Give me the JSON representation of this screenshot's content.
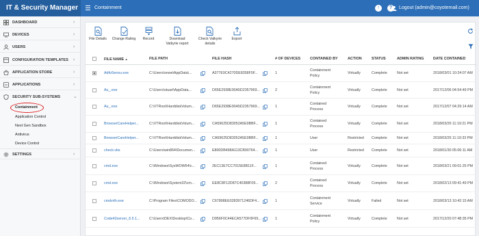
{
  "header": {
    "brand": "IT & Security Manager",
    "page_title": "Containment",
    "logout": "Logout (admin@coyotemail.com)"
  },
  "sidebar": {
    "items": [
      {
        "label": "DASHBOARD",
        "icon": "dashboard-icon"
      },
      {
        "label": "DEVICES",
        "icon": "devices-icon"
      },
      {
        "label": "USERS",
        "icon": "users-icon"
      },
      {
        "label": "CONFIGURATION TEMPLATES",
        "icon": "templates-icon"
      },
      {
        "label": "APPLICATION STORE",
        "icon": "store-icon"
      },
      {
        "label": "APPLICATIONS",
        "icon": "applications-icon"
      },
      {
        "label": "SECURITY SUB-SYSTEMS",
        "icon": "shield-icon"
      },
      {
        "label": "SETTINGS",
        "icon": "gear-icon"
      }
    ],
    "subitems": [
      "Containment",
      "Application Control",
      "Next Gen Sandbox",
      "Antivirus",
      "Device Control"
    ]
  },
  "toolbar": {
    "file_details": "File Details",
    "change_rating": "Change Rating",
    "record": "Record",
    "download_valkyrie_1": "Download",
    "download_valkyrie_2": "Valkyrie report",
    "check_valkyrie_1": "Check Valkyrie",
    "check_valkyrie_2": "details",
    "export": "Export"
  },
  "table": {
    "columns": [
      "FILE NAME",
      "FILE PATH",
      "FILE HASH",
      "# OF DEVICES",
      "CONTAINED BY",
      "ACTION",
      "STATUS",
      "ADMIN RATING",
      "DATE CONTAINED"
    ],
    "sort_indicator": "▲",
    "rows": [
      {
        "name": "AdfoSensu.exe",
        "path": "C:\\Users\\snow\\AppData\\...",
        "hash": "A377E9C4270DE8358F5F...",
        "devices": "1",
        "contained_by_1": "Containment",
        "contained_by_2": "Policy",
        "action": "Virtually",
        "status": "Complete",
        "rating": "Not set",
        "date": "2018/03/01 10:24:07 AM"
      },
      {
        "name": "Au_.exe",
        "path": "C:\\Users\\stuart\\AppData...",
        "hash": "D65E2938E00A5D2357969...",
        "devices": "2",
        "contained_by_1": "Containment",
        "contained_by_2": "Policy",
        "action": "Virtually",
        "status": "Complete",
        "rating": "Not set",
        "date": "2017/12/06 04:54:49 PM"
      },
      {
        "name": "Au_.exe",
        "path": "C:\\VTRoot\\HarddiskVolum...",
        "hash": "D65E2938E00A5D2357969...",
        "devices": "1",
        "contained_by_1": "Contained",
        "contained_by_2": "Process",
        "action": "Virtually",
        "status": "Complete",
        "rating": "Not set",
        "date": "2017/12/07 04:29:14 AM"
      },
      {
        "name": "BrowserCareHelper...",
        "path": "C:\\VTRoot\\HarddiskVolum...",
        "hash": "CA59625D83052A5E9BBF...",
        "devices": "1",
        "contained_by_1": "Contained",
        "contained_by_2": "Process",
        "action": "Virtually",
        "status": "Complete",
        "rating": "Not set",
        "date": "2018/03/26 11:19:21 PM"
      },
      {
        "name": "BrowserCareHelper...",
        "path": "C:\\VTRoot\\HarddiskVolum...",
        "hash": "CA59625D83052A5E9BBF...",
        "devices": "1",
        "contained_by_1": "User",
        "contained_by_2": "",
        "action": "Restricted",
        "status": "Complete",
        "rating": "Not set",
        "date": "2018/03/26 11:19:33 PM"
      },
      {
        "name": "check.vbs",
        "path": "C:\\Users\\win864\\Documen...",
        "hash": "E800DB498A113CB90764...",
        "devices": "1",
        "contained_by_1": "User",
        "contained_by_2": "",
        "action": "Restricted",
        "status": "Complete",
        "rating": "Not set",
        "date": "2018/01/30 05:06:11 AM"
      },
      {
        "name": "cmd.exe",
        "path": "C:\\Windows\\SysWOW64\\c...",
        "hash": "2EC13E7CC7015E8B11F...",
        "devices": "1",
        "contained_by_1": "Contained",
        "contained_by_2": "Process",
        "action": "Virtually",
        "status": "Complete",
        "rating": "Not set",
        "date": "2018/03/21 09:01:25 PM"
      },
      {
        "name": "cmd.exe",
        "path": "C:\\Windows\\System32\\cm...",
        "hash": "EE8C8F12D87C40388F09...",
        "devices": "2",
        "contained_by_1": "Contained",
        "contained_by_2": "Process",
        "action": "Virtually",
        "status": "Complete",
        "rating": "Not set",
        "date": "2018/02/13 09:41:49 PM"
      },
      {
        "name": "cmdvrth.exe",
        "path": "C:\\Program Files\\COMODO...",
        "hash": "C67898EE0283971246DF4...",
        "devices": "1",
        "contained_by_1": "Containment",
        "contained_by_2": "Service",
        "action": "Virtually",
        "status": "Failed",
        "rating": "Not set",
        "date": "2018/03/13 10:42:15 AM"
      },
      {
        "name": "Code42server_6.5.1...",
        "path": "C:\\Users\\DEX\\Desktop\\Co...",
        "hash": "D956F0C44ECA577DF0F65...",
        "devices": "1",
        "contained_by_1": "Containment",
        "contained_by_2": "Policy",
        "action": "Virtually",
        "status": "Complete",
        "rating": "Not set",
        "date": "2017/12/20 07:48:35 PM"
      }
    ]
  }
}
